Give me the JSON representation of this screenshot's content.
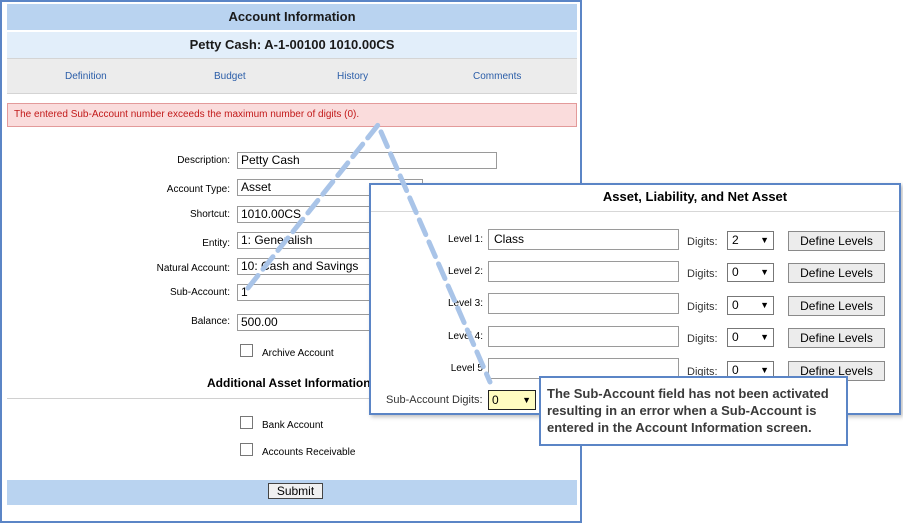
{
  "account": {
    "title": "Account Information",
    "subtitle": "Petty Cash: A-1-00100 1010.00CS",
    "tabs": [
      "Definition",
      "Budget",
      "History",
      "Comments"
    ],
    "error": "The entered Sub-Account number exceeds the maximum number of digits (0).",
    "fields": {
      "description_label": "Description:",
      "description_value": "Petty Cash",
      "account_type_label": "Account Type:",
      "account_type_value": "Asset",
      "shortcut_label": "Shortcut:",
      "shortcut_value": "1010.00CS",
      "entity_label": "Entity:",
      "entity_value": "1: Generalish",
      "natural_account_label": "Natural Account:",
      "natural_account_value": "10: Cash and Savings",
      "sub_account_label": "Sub-Account:",
      "sub_account_value": "1",
      "balance_label": "Balance:",
      "balance_value": "500.00"
    },
    "archive_label": "Archive Account",
    "additional_header": "Additional Asset Information",
    "bank_account_label": "Bank Account",
    "accounts_receivable_label": "Accounts Receivable",
    "submit_label": "Submit"
  },
  "levels": {
    "title": "Asset, Liability, and Net Asset",
    "digits_label": "Digits:",
    "define_label": "Define Levels",
    "rows": [
      {
        "label": "Level 1:",
        "value": "Class",
        "digits": "2"
      },
      {
        "label": "Level 2:",
        "value": "",
        "digits": "0"
      },
      {
        "label": "Level 3:",
        "value": "",
        "digits": "0"
      },
      {
        "label": "Level 4:",
        "value": "",
        "digits": "0"
      },
      {
        "label": "Level 5",
        "value": "",
        "digits": "0"
      }
    ],
    "sub_account_digits_label": "Sub-Account Digits:",
    "sub_account_digits_value": "0"
  },
  "callout": {
    "text": "The Sub-Account field has not been activated resulting in an error when a Sub-Account is entered in the Account Information screen."
  },
  "colors": {
    "window_border": "#5b85c6",
    "title_bar": "#b9d3f0",
    "error_text": "#c21a1a",
    "connector": "#a9c4e8"
  }
}
